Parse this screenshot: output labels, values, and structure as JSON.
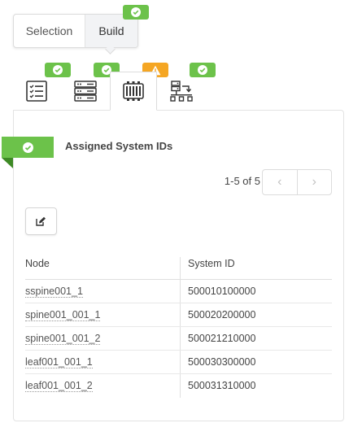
{
  "mode_toggle": {
    "selection_label": "Selection",
    "build_label": "Build",
    "build_status_icon": "check-icon"
  },
  "tabs": [
    {
      "icon": "list-icon",
      "status": "ok"
    },
    {
      "icon": "server-rack-icon",
      "status": "ok"
    },
    {
      "icon": "device-chip-icon",
      "status": "warning",
      "active": true
    },
    {
      "icon": "network-topology-icon",
      "status": "ok"
    }
  ],
  "section": {
    "title": "Assigned System IDs",
    "status_icon": "check-icon"
  },
  "pagination": {
    "range_text": "1-5 of 5",
    "prev_label": "‹",
    "next_label": "›"
  },
  "table": {
    "columns": [
      "Node",
      "System ID"
    ],
    "rows": [
      {
        "node": "sspine001_1",
        "system_id": "500010100000"
      },
      {
        "node": "spine001_001_1",
        "system_id": "500020200000"
      },
      {
        "node": "spine001_001_2",
        "system_id": "500021210000"
      },
      {
        "node": "leaf001_001_1",
        "system_id": "500030300000"
      },
      {
        "node": "leaf001_001_2",
        "system_id": "500031310000"
      }
    ]
  },
  "colors": {
    "ok": "#6cc24a",
    "warning": "#f5a623",
    "ribbon_fold": "#3e8a25"
  }
}
